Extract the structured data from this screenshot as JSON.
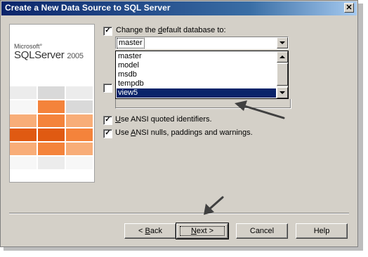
{
  "window": {
    "title": "Create a New Data Source to SQL Server",
    "close_glyph": "✕"
  },
  "logo": {
    "company": "Microsoft°",
    "product": "SQLServer",
    "year": "2005"
  },
  "options": {
    "change_db": {
      "checked": true,
      "label_prefix": "Change the ",
      "label_mnemonic": "d",
      "label_suffix": "efault database to:"
    },
    "combo_value": "master",
    "list_items": [
      "master",
      "model",
      "msdb",
      "tempdb",
      "view5"
    ],
    "selected_item": "view5",
    "ansi_quoted": {
      "checked": true,
      "label_mnemonic": "U",
      "label_suffix": "se ANSI quoted identifiers."
    },
    "ansi_nulls": {
      "checked": true,
      "label_prefix": "Use ",
      "label_mnemonic": "A",
      "label_suffix": "NSI nulls, paddings and warnings."
    }
  },
  "buttons": {
    "back": {
      "prefix": "< ",
      "mnemonic": "B",
      "suffix": "ack"
    },
    "next": {
      "prefix": "",
      "mnemonic": "N",
      "suffix": "ext >"
    },
    "cancel": "Cancel",
    "help": "Help"
  },
  "colors": {
    "title_gradient_start": "#0a246a",
    "selection": "#0a246a",
    "dialog_face": "#d4d0c8",
    "logo_accent": "#f4833b",
    "annotation_arrow": "#404040"
  }
}
